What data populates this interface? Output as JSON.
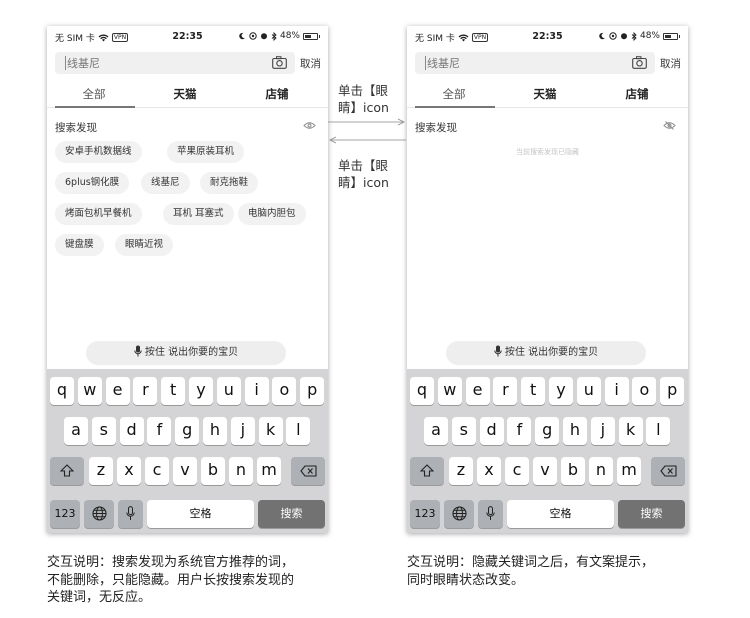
{
  "status_bar": {
    "carrier": "无 SIM 卡",
    "vpn": "VPN",
    "time": "22:35",
    "battery": "48%"
  },
  "search": {
    "placeholder": "线基尼",
    "cancel_label": "取消"
  },
  "tabs": [
    {
      "label": "全部"
    },
    {
      "label": "天猫"
    },
    {
      "label": "店铺"
    }
  ],
  "section": {
    "title": "搜索发现"
  },
  "chips": [
    {
      "label": "安卓手机数据线"
    },
    {
      "label": "苹果原装耳机"
    },
    {
      "label": "6plus钢化膜"
    },
    {
      "label": "线基尼"
    },
    {
      "label": "耐克拖鞋"
    },
    {
      "label": "烤面包机早餐机"
    },
    {
      "label": "耳机 耳塞式"
    },
    {
      "label": "电脑内胆包"
    },
    {
      "label": "键盘膜"
    },
    {
      "label": "眼睛近视"
    }
  ],
  "hidden_hint": "当前搜索发现已隐藏",
  "voice": {
    "label": "按住 说出你要的宝贝"
  },
  "keyboard": {
    "row1": [
      "q",
      "w",
      "e",
      "r",
      "t",
      "y",
      "u",
      "i",
      "o",
      "p"
    ],
    "row2": [
      "a",
      "s",
      "d",
      "f",
      "g",
      "h",
      "j",
      "k",
      "l"
    ],
    "row3": [
      "z",
      "x",
      "c",
      "v",
      "b",
      "n",
      "m"
    ],
    "num_label": "123",
    "space_label": "空格",
    "search_label": "搜索"
  },
  "annotations": {
    "to_right_line1": "单击【眼",
    "to_right_line2": "睛】icon",
    "to_left_line1": "单击【眼",
    "to_left_line2": "睛】icon"
  },
  "captions": {
    "left_line1": "交互说明：搜索发现为系统官方推荐的词，",
    "left_line2": "不能删除，只能隐藏。用户长按搜索发现的",
    "left_line3": "关键词，无反应。",
    "right_line1": "交互说明：隐藏关键词之后，有文案提示，",
    "right_line2": "同时眼睛状态改变。"
  }
}
